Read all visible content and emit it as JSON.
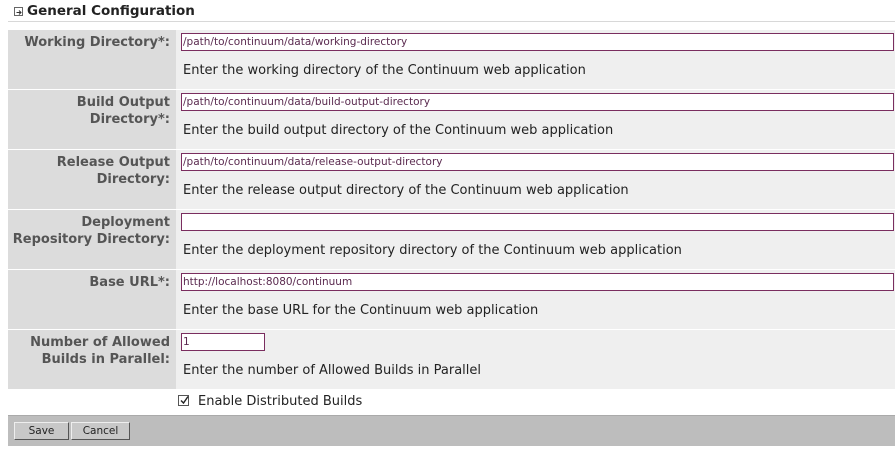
{
  "section": {
    "title": "General Configuration",
    "icon": "expand-arrow-icon"
  },
  "fields": [
    {
      "label": "Working Directory*:",
      "value": "/path/to/continuum/data/working-directory",
      "help": "Enter the working directory of the Continuum web application"
    },
    {
      "label_line1": "Build Output",
      "label_line2": "Directory*:",
      "value": "/path/to/continuum/data/build-output-directory",
      "help": "Enter the build output directory of the Continuum web application"
    },
    {
      "label_line1": "Release Output",
      "label_line2": "Directory:",
      "value": "/path/to/continuum/data/release-output-directory",
      "help": "Enter the release output directory of the Continuum web application"
    },
    {
      "label_line1": "Deployment",
      "label_line2": "Repository Directory:",
      "value": "",
      "help": "Enter the deployment repository directory of the Continuum web application"
    },
    {
      "label": "Base URL*:",
      "value": "http://localhost:8080/continuum",
      "help": "Enter the base URL for the Continuum web application"
    },
    {
      "label_line1": "Number of Allowed",
      "label_line2": "Builds in Parallel:",
      "value": "1",
      "help": "Enter the number of Allowed Builds in Parallel"
    }
  ],
  "distributed": {
    "label": "Enable Distributed Builds",
    "checked": true
  },
  "buttons": {
    "save": "Save",
    "cancel": "Cancel"
  },
  "colors": {
    "label_bg": "#dcdcdc",
    "field_bg": "#efefef",
    "input_border": "#7a2e5f",
    "button_bar_bg": "#bdbdbd"
  }
}
